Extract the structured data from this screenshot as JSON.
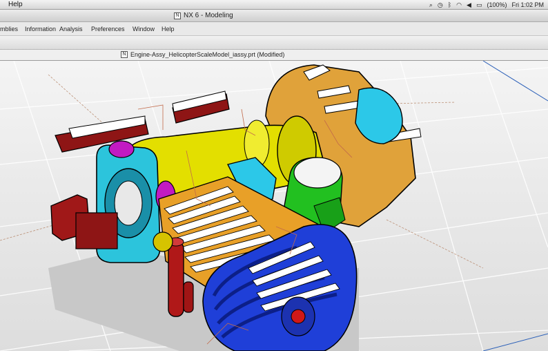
{
  "macos_menubar": {
    "app_menu_item": "Help",
    "battery_percent": "(100%)",
    "clock": "Fri 1:02 PM"
  },
  "window": {
    "title": "NX 6 - Modeling"
  },
  "app_menu": {
    "items": [
      "mblies",
      "Information",
      "Analysis",
      "Preferences",
      "Window",
      "Help"
    ]
  },
  "document": {
    "tab_title": "Engine-Assy_HelicopterScaleModel_iassy.prt (Modified)"
  },
  "icons": {
    "status": [
      "search-icon",
      "clock-icon",
      "bluetooth-icon",
      "wifi-icon",
      "volume-icon",
      "battery-icon"
    ]
  }
}
